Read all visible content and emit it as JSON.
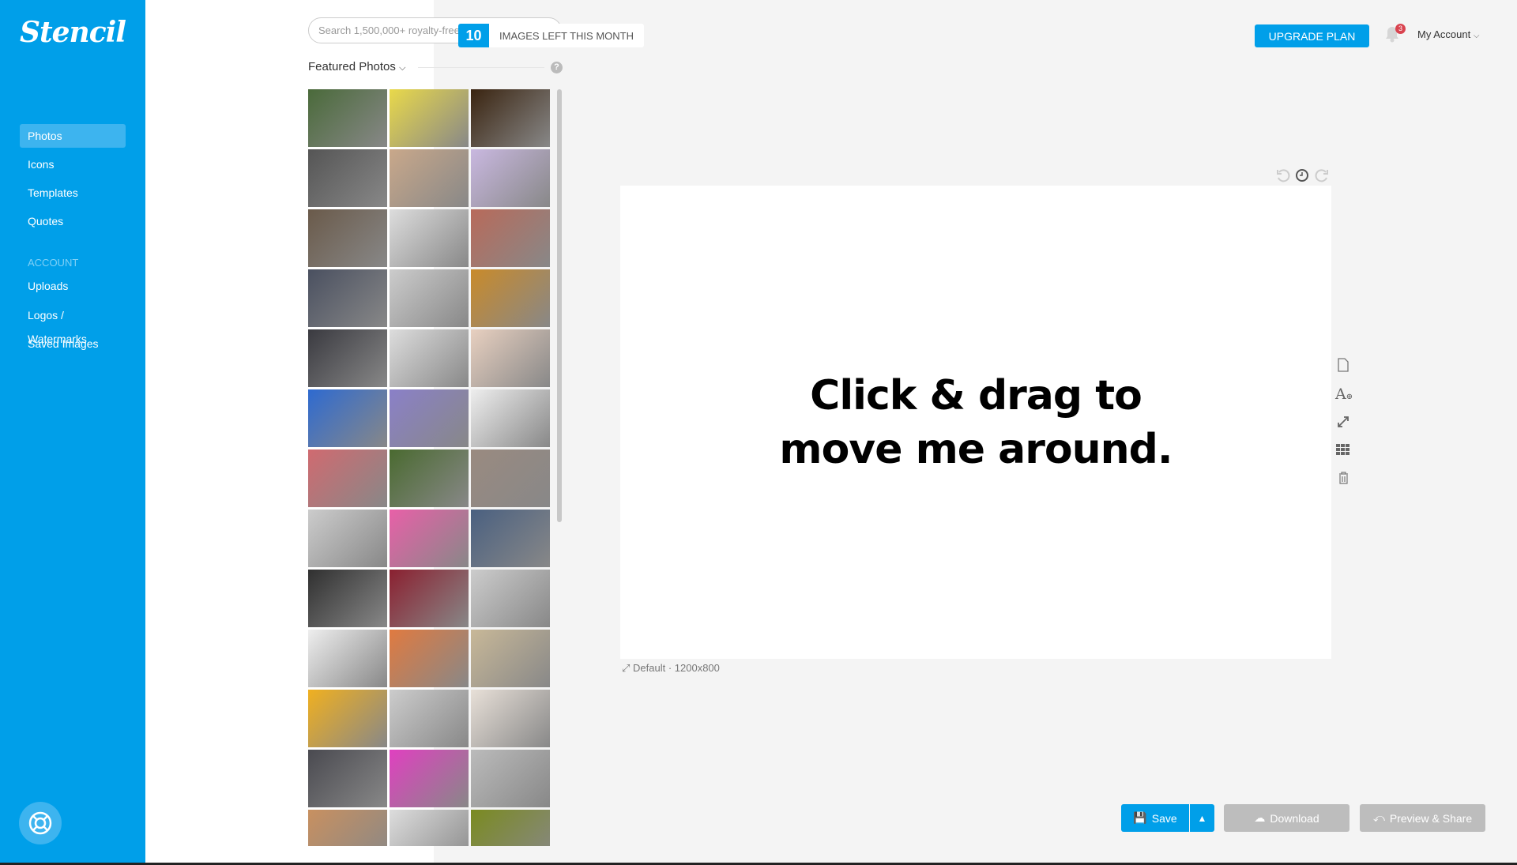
{
  "app": {
    "logo": "Stencil"
  },
  "sidebar": {
    "items": [
      {
        "label": "Photos",
        "active": true
      },
      {
        "label": "Icons"
      },
      {
        "label": "Templates"
      },
      {
        "label": "Quotes"
      }
    ],
    "section_label": "ACCOUNT",
    "account_items": [
      {
        "label": "Uploads"
      },
      {
        "label": "Logos / Watermarks"
      },
      {
        "label": "Saved Images"
      }
    ],
    "help_icon": "lifebuoy-icon"
  },
  "panel": {
    "search_placeholder": "Search 1,500,000+ royalty-free photos",
    "section_title": "Featured Photos",
    "help": "?",
    "thumbnail_colors": [
      "#4a6a3a",
      "#e9d94a",
      "#3a2410",
      "#555",
      "#c9a88a",
      "#c9b8e0",
      "#6a5a4a",
      "#ddd",
      "#b86a5a",
      "#4a5060",
      "#ccc",
      "#c98a2a",
      "#3a3a40",
      "#ddd",
      "#e8d0c0",
      "#2e6ad0",
      "#8a80c8",
      "#eee",
      "#d06a70",
      "#4a6a30",
      "#9a8a80",
      "#ccc",
      "#e860a8",
      "#4a6080",
      "#303030",
      "#8a2030",
      "#ccc",
      "#eee",
      "#e07a40",
      "#c8b898",
      "#f0b020",
      "#ccc",
      "#e8e0d8",
      "#4a4a50",
      "#e040c0",
      "#bbb",
      "#c89060",
      "#ddd",
      "#7a8a20"
    ]
  },
  "header": {
    "count": "10",
    "count_label": "IMAGES LEFT THIS MONTH",
    "upgrade": "UPGRADE PLAN",
    "notifications": "3",
    "account": "My Account"
  },
  "canvas": {
    "line1": "Click & drag to",
    "line2": "move me around.",
    "size_label": "Default · 1200x800"
  },
  "footer": {
    "save": "Save",
    "download": "Download",
    "preview": "Preview & Share"
  },
  "colors": {
    "brand": "#009fe9",
    "disabled": "#bdbdbd",
    "badge": "#d9434f"
  }
}
